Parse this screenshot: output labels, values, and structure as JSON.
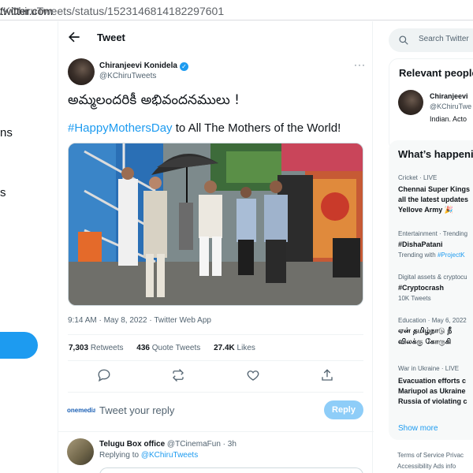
{
  "browser": {
    "url_host": "twitter.com",
    "url_path": "/KChiruTweets/status/1523146814182297601"
  },
  "left_nav": {
    "fragments": [
      "ns",
      "s"
    ]
  },
  "header": {
    "title": "Tweet"
  },
  "tweet": {
    "author_name": "Chiranjeevi Konidela",
    "author_handle": "@KChiruTweets",
    "verified_mark": "✓",
    "more_glyph": "···",
    "text_line1": "అమ్మలందరికీ అభివందనములు !",
    "hashtag": "#HappyMothersDay",
    "text_line2_rest": " to All The Mothers of the World!",
    "timestamp": "9:14 AM · May 8, 2022 · Twitter Web App",
    "retweets_count": "7,303",
    "retweets_label": "Retweets",
    "quotes_count": "436",
    "quotes_label": "Quote Tweets",
    "likes_count": "27.4K",
    "likes_label": "Likes"
  },
  "reply_composer": {
    "logo_text": "onemedia",
    "placeholder": "Tweet your reply",
    "button_label": "Reply"
  },
  "reply": {
    "name": "Telugu Box office",
    "handle_and_time": " @TCinemaFun · 3h",
    "replying_to_label": "Replying to ",
    "replying_to_handle": "@KChiruTweets"
  },
  "right": {
    "search_placeholder": "Search Twitter",
    "relevant_title": "Relevant people",
    "relevant_name": "Chiranjeevi",
    "relevant_handle": "@KChiruTwe",
    "relevant_bio": "Indian. Acto",
    "happening_title": "What’s happening",
    "trends": [
      {
        "category": "Cricket · LIVE",
        "title_lines": [
          "Chennai Super Kings",
          "all the latest updates",
          "Yellove Army 🎉"
        ]
      },
      {
        "category": "Entertainment · Trending",
        "title_lines": [
          "#DishaPatani"
        ],
        "sub_prefix": "Trending with ",
        "sub_link": "#ProjectK"
      },
      {
        "category": "Digital assets & cryptocu",
        "title_lines": [
          "#Cryptocrash"
        ],
        "sub": "10K Tweets"
      },
      {
        "category": "Education · May 6, 2022",
        "title_lines": [
          "ஏன் தமிழ்நாடு நீ",
          "விலக்கு கோருகி"
        ]
      },
      {
        "category": "War in Ukraine · LIVE",
        "title_lines": [
          "Evacuation efforts c",
          "Mariupol as Ukraine",
          "Russia of violating c"
        ]
      }
    ],
    "show_more": "Show more",
    "footer_line1": "Terms of Service   Privac",
    "footer_line2": "Accessibility   Ads info"
  }
}
